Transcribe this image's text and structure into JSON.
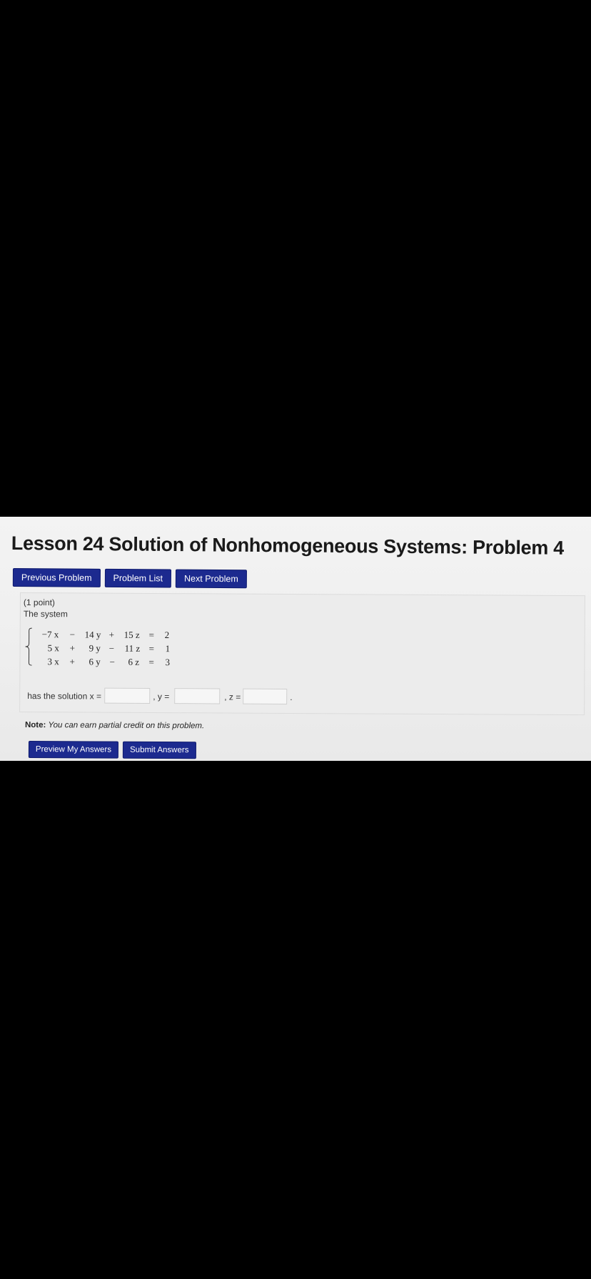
{
  "page": {
    "title": "Lesson 24 Solution of Nonhomogeneous Systems: Problem 4"
  },
  "nav": {
    "previous": "Previous Problem",
    "list": "Problem List",
    "next": "Next Problem"
  },
  "problem": {
    "points": "(1 point)",
    "intro": "The system",
    "equations": [
      {
        "a": "−7 x",
        "op1": "−",
        "b": "14 y",
        "op2": "+",
        "c": "15 z",
        "eq": "=",
        "rhs": "2"
      },
      {
        "a": "5 x",
        "op1": "+",
        "b": "9 y",
        "op2": "−",
        "c": "11 z",
        "eq": "=",
        "rhs": "1"
      },
      {
        "a": "3 x",
        "op1": "+",
        "b": "6 y",
        "op2": "−",
        "c": "6 z",
        "eq": "=",
        "rhs": "3"
      }
    ],
    "solution_label": "has the solution x =",
    "y_label": ", y =",
    "z_label": ", z =",
    "end_period": ".",
    "answers": {
      "x": "",
      "y": "",
      "z": ""
    }
  },
  "note": {
    "label": "Note:",
    "text": "You can earn partial credit on this problem."
  },
  "actions": {
    "preview": "Preview My Answers",
    "submit": "Submit Answers"
  },
  "colors": {
    "button_bg": "#1c2a8f",
    "panel_bg": "#ececec",
    "background": "#000000"
  }
}
